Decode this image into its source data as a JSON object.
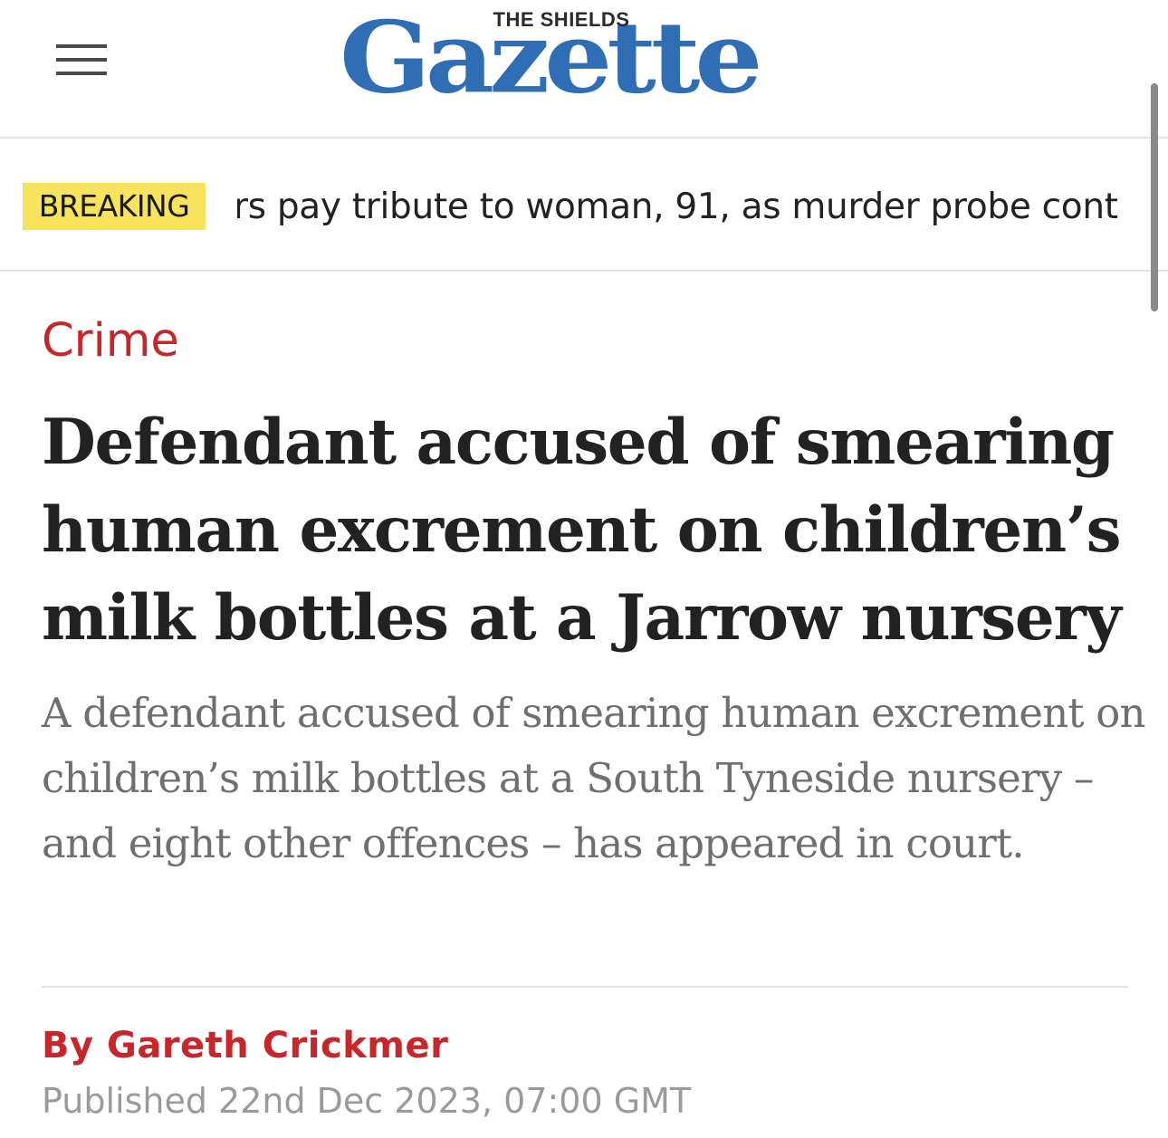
{
  "header": {
    "menu_icon": "hamburger-menu-icon",
    "logo_superscript": "THE SHIELDS",
    "logo_title": "Gazette",
    "logo_color": "#2f6db5"
  },
  "breaking": {
    "badge": "BREAKING",
    "badge_color": "#f7e35c",
    "ticker_text": "rs pay tribute to woman, 91, as murder probe cont"
  },
  "article": {
    "category": "Crime",
    "accent_color": "#c8262b",
    "headline": "Defendant accused of smearing human excrement on children’s milk bottles at a Jarrow nursery",
    "standfirst": "A defendant accused of smearing human excrement on children’s milk bottles at a South Tyneside nursery – and eight other offences – has appeared in court.",
    "byline_prefix": "By",
    "author": "Gareth Crickmer",
    "published": "Published 22nd Dec 2023, 07:00 GMT"
  }
}
